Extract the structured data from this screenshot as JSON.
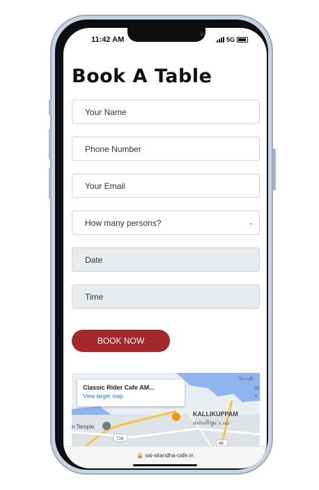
{
  "status_bar": {
    "time": "11:42 AM",
    "network": "5G"
  },
  "page": {
    "title": "Book A Table"
  },
  "form": {
    "name_placeholder": "Your Name",
    "phone_placeholder": "Phone Number",
    "email_placeholder": "Your Email",
    "persons_selected": "How many persons?",
    "date_label": "Date",
    "time_label": "Time",
    "submit_label": "BOOK NOW"
  },
  "map": {
    "place_name": "Classic Rider Cafe AM...",
    "view_larger_label": "View larger map",
    "area_label": "KALLIKUPPAM",
    "area_label_tamil": "கள்ளிகுப்பம்",
    "temple_label": "n Temple",
    "road_716": "716",
    "road_48": "48",
    "partial_label_1": "பொதி",
    "partial_label_2": "SU",
    "partial_label_3": "சு"
  },
  "browser": {
    "url": "sai-skandha-cafe.in",
    "lock_icon": "lock-icon"
  },
  "colors": {
    "accent": "#a5282d",
    "map_water": "#8fb4f0",
    "map_road": "#f6c342"
  }
}
